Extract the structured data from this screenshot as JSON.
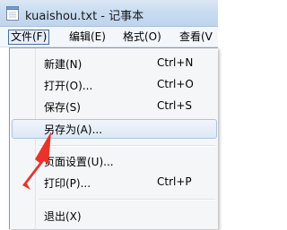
{
  "window": {
    "title": "kuaishou.txt - 记事本",
    "app_icon": "notepad-icon"
  },
  "menubar": {
    "items": [
      {
        "label": "文件(F)",
        "active": true
      },
      {
        "label": "编辑(E)",
        "active": false
      },
      {
        "label": "格式(O)",
        "active": false
      },
      {
        "label": "查看(V",
        "active": false
      }
    ]
  },
  "file_menu": {
    "items": [
      {
        "label": "新建(N)",
        "shortcut": "Ctrl+N"
      },
      {
        "label": "打开(O)...",
        "shortcut": "Ctrl+O"
      },
      {
        "label": "保存(S)",
        "shortcut": "Ctrl+S"
      },
      {
        "label": "另存为(A)...",
        "shortcut": "",
        "highlighted": true
      },
      {
        "label": "页面设置(U)...",
        "shortcut": ""
      },
      {
        "label": "打印(P)...",
        "shortcut": "Ctrl+P"
      },
      {
        "label": "退出(X)",
        "shortcut": ""
      }
    ]
  },
  "annotation": {
    "type": "red-arrow",
    "color": "#e8332b",
    "points_to": "另存为(A)..."
  },
  "colors": {
    "menu_background": "#f5f6f7",
    "highlight_border": "#a8c5e8",
    "titlebar": "#c9dcf1"
  }
}
